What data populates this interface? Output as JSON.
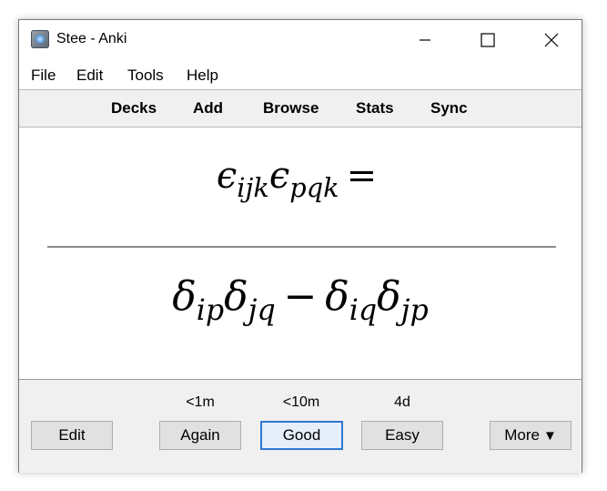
{
  "window": {
    "title": "Stee - Anki",
    "controls": {
      "minimize_icon": "minimize-icon",
      "maximize_icon": "maximize-icon",
      "close_icon": "close-icon"
    }
  },
  "menu": {
    "items": [
      "File",
      "Edit",
      "Tools",
      "Help"
    ]
  },
  "toolbar": {
    "items": [
      "Decks",
      "Add",
      "Browse",
      "Stats",
      "Sync"
    ]
  },
  "card": {
    "front": {
      "symbol": "ϵ",
      "sub1": "ijk",
      "sub2": "pqk",
      "equals": "="
    },
    "back": {
      "symbol": "δ",
      "sub1": "ip",
      "sub2": "jq",
      "minus": "−",
      "sub3": "iq",
      "sub4": "jp"
    }
  },
  "answer_bar": {
    "edit_label": "Edit",
    "buttons": [
      {
        "label": "Again",
        "interval": "<1m"
      },
      {
        "label": "Good",
        "interval": "<10m"
      },
      {
        "label": "Easy",
        "interval": "4d"
      }
    ],
    "more_label": "More",
    "more_arrow": "▼"
  },
  "colors": {
    "accent": "#2f78d0",
    "bar_background": "#f0f0f0"
  }
}
